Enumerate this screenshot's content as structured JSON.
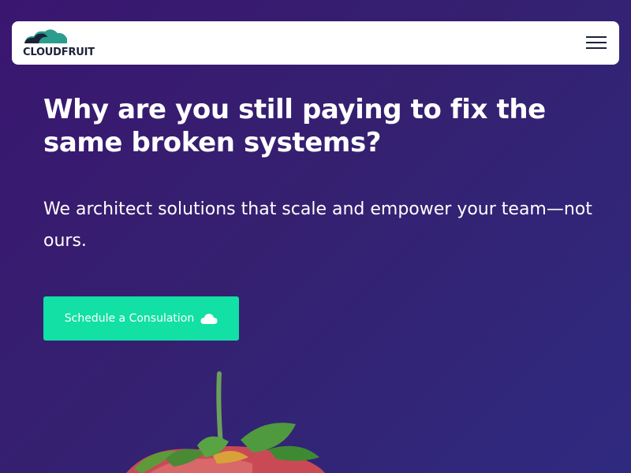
{
  "brand": {
    "name": "CLOUDFRUIT",
    "colors": {
      "primary": "#1b2238",
      "accent": "#12e0a4",
      "leaf": "#2a9d8f"
    }
  },
  "nav": {
    "menu_icon": "hamburger-menu-icon"
  },
  "hero": {
    "title": "Why are you still paying to fix the same broken systems?",
    "subtitle": "We architect solutions that scale and empower your team—not ours.",
    "cta": {
      "label": "Schedule a Consulation",
      "icon": "cloud-icon"
    }
  },
  "illustration": {
    "icon": "strawberry-image"
  }
}
